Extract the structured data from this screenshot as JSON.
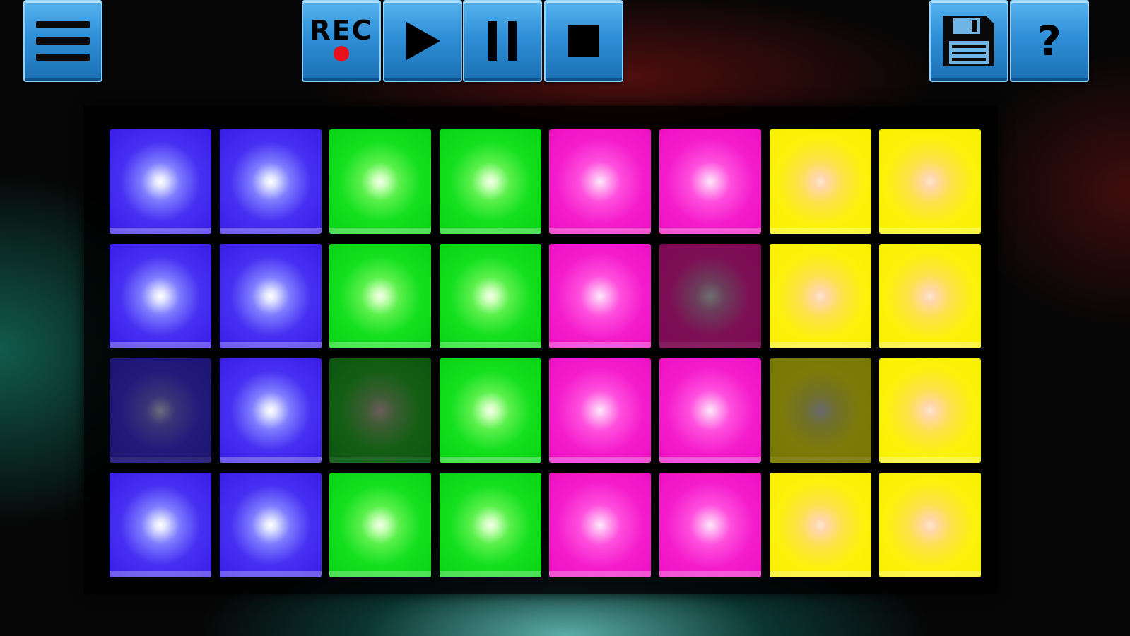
{
  "toolbar": {
    "menu_icon": "hamburger-menu-icon",
    "rec_label": "REC",
    "rec_dot_color": "#e8101a",
    "play_icon": "play-icon",
    "pause_icon": "pause-icon",
    "stop_icon": "stop-icon",
    "save_icon": "floppy-disk-icon",
    "help_label": "?",
    "button_color": "#2f8fd6"
  },
  "pads": {
    "colors": {
      "blue": "#3a1de8",
      "green": "#08d414",
      "magenta": "#ee10c2",
      "yellow": "#f8f000"
    },
    "rows": [
      [
        {
          "color": "blue",
          "active": true
        },
        {
          "color": "blue",
          "active": true
        },
        {
          "color": "green",
          "active": true
        },
        {
          "color": "green",
          "active": true
        },
        {
          "color": "magenta",
          "active": true
        },
        {
          "color": "magenta",
          "active": true
        },
        {
          "color": "yellow",
          "active": true
        },
        {
          "color": "yellow",
          "active": true
        }
      ],
      [
        {
          "color": "blue",
          "active": true
        },
        {
          "color": "blue",
          "active": true
        },
        {
          "color": "green",
          "active": true
        },
        {
          "color": "green",
          "active": true
        },
        {
          "color": "magenta",
          "active": true
        },
        {
          "color": "magenta",
          "active": false
        },
        {
          "color": "yellow",
          "active": true
        },
        {
          "color": "yellow",
          "active": true
        }
      ],
      [
        {
          "color": "blue",
          "active": false
        },
        {
          "color": "blue",
          "active": true
        },
        {
          "color": "green",
          "active": false
        },
        {
          "color": "green",
          "active": true
        },
        {
          "color": "magenta",
          "active": true
        },
        {
          "color": "magenta",
          "active": true
        },
        {
          "color": "yellow",
          "active": false
        },
        {
          "color": "yellow",
          "active": true
        }
      ],
      [
        {
          "color": "blue",
          "active": true
        },
        {
          "color": "blue",
          "active": true
        },
        {
          "color": "green",
          "active": true
        },
        {
          "color": "green",
          "active": true
        },
        {
          "color": "magenta",
          "active": true
        },
        {
          "color": "magenta",
          "active": true
        },
        {
          "color": "yellow",
          "active": true
        },
        {
          "color": "yellow",
          "active": true
        }
      ]
    ]
  }
}
